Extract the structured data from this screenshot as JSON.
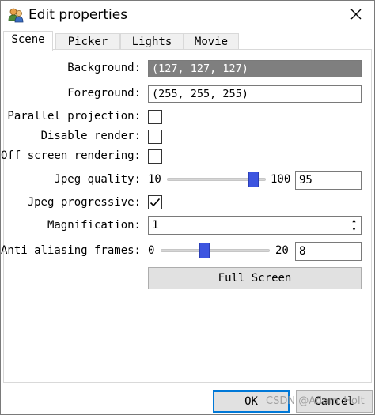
{
  "window": {
    "title": "Edit properties",
    "icon": "users-icon"
  },
  "tabs": [
    {
      "label": "Scene",
      "active": true
    },
    {
      "label": "Picker",
      "active": false
    },
    {
      "label": "Lights",
      "active": false
    },
    {
      "label": "Movie",
      "active": false
    }
  ],
  "scene": {
    "background_label": "Background:",
    "background_value": "(127, 127, 127)",
    "background_color": "#7f7f7f",
    "foreground_label": "Foreground:",
    "foreground_value": "(255, 255, 255)",
    "foreground_color": "#ffffff",
    "parallel_projection_label": "Parallel projection:",
    "parallel_projection_checked": false,
    "disable_render_label": "Disable render:",
    "disable_render_checked": false,
    "off_screen_rendering_label": "Off screen rendering:",
    "off_screen_rendering_checked": false,
    "jpeg_quality_label": "Jpeg quality:",
    "jpeg_quality_min": "10",
    "jpeg_quality_max": "100",
    "jpeg_quality_value": "95",
    "jpeg_progressive_label": "Jpeg progressive:",
    "jpeg_progressive_checked": true,
    "magnification_label": "Magnification:",
    "magnification_value": "1",
    "anti_aliasing_label": "Anti aliasing frames:",
    "anti_aliasing_min": "0",
    "anti_aliasing_max": "20",
    "anti_aliasing_value": "8",
    "full_screen_label": "Full Screen"
  },
  "footer": {
    "ok_label": "OK",
    "cancel_label": "Cancel"
  },
  "watermark": "CSDN @Adam_Holt",
  "colors": {
    "slider_thumb": "#3d55e0",
    "focus_border": "#0078d7"
  }
}
